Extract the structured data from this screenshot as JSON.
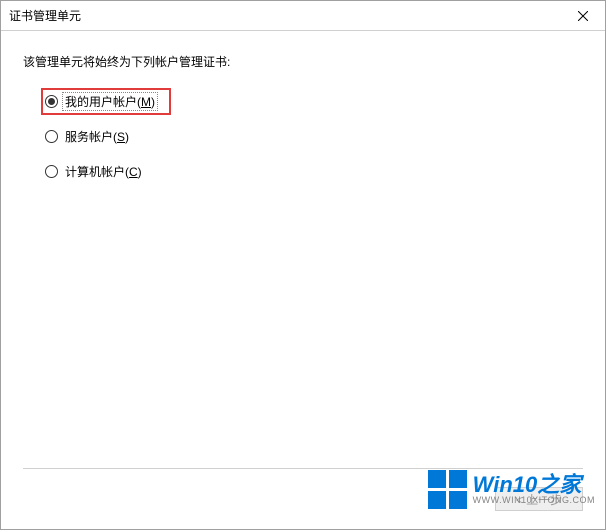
{
  "window": {
    "title": "证书管理单元"
  },
  "instruction": "该管理单元将始终为下列帐户管理证书:",
  "options": {
    "myUser": {
      "label": "我的用户帐户(",
      "mnemonic": "M",
      "suffix": ")"
    },
    "service": {
      "label": "服务帐户(",
      "mnemonic": "S",
      "suffix": ")"
    },
    "computer": {
      "label": "计算机帐户(",
      "mnemonic": "C",
      "suffix": ")"
    }
  },
  "buttons": {
    "back": "< 上一步"
  },
  "watermark": {
    "main": "Win10之家",
    "sub": "WWW.WIN10XITONG.COM"
  }
}
